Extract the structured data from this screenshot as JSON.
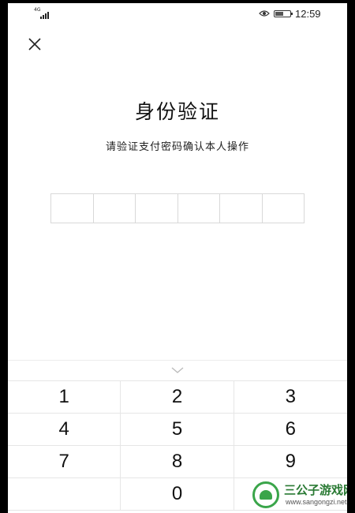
{
  "status_bar": {
    "network": "4G",
    "time": "12:59",
    "battery_level": 0.55
  },
  "dialog": {
    "title": "身份验证",
    "subtitle": "请验证支付密码确认本人操作",
    "pin_length": 6
  },
  "keypad": {
    "keys": [
      "1",
      "2",
      "3",
      "4",
      "5",
      "6",
      "7",
      "8",
      "9",
      "",
      "0",
      ""
    ]
  },
  "watermark": {
    "name": "三公子游戏网",
    "url": "www.sangongzi.net"
  },
  "icons": {
    "close": "close-icon",
    "collapse": "chevron-down-icon",
    "eye": "eye-icon",
    "battery": "battery-icon",
    "signal": "signal-icon"
  }
}
